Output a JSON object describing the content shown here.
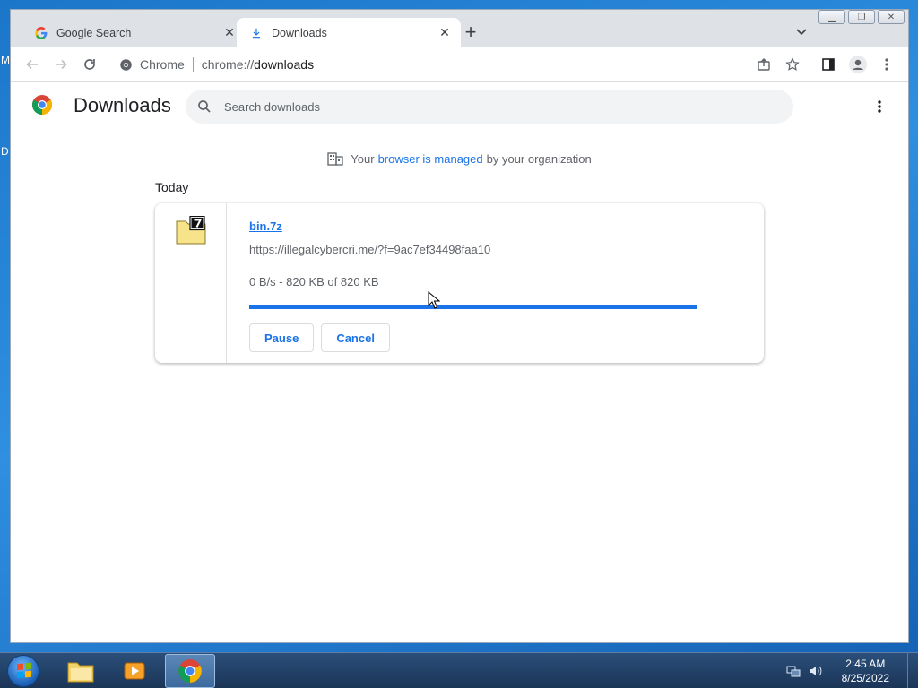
{
  "browser": {
    "tabs": [
      {
        "title": "Google Search",
        "icon": "google-icon"
      },
      {
        "title": "Downloads",
        "icon": "download-icon"
      }
    ],
    "omnibox": {
      "site_label": "Chrome",
      "url_prefix": "chrome://",
      "url_path": "downloads"
    }
  },
  "page": {
    "title": "Downloads",
    "search_placeholder": "Search downloads",
    "managed": {
      "prefix": "Your",
      "link": "browser is managed",
      "suffix": "by your organization"
    },
    "date_header": "Today",
    "download": {
      "file_name": "bin.7z",
      "url": "https://illegalcybercri.me/?f=9ac7ef34498faa10",
      "status": "0 B/s - 820 KB of 820 KB",
      "progress_percent": 100,
      "pause_label": "Pause",
      "cancel_label": "Cancel"
    }
  },
  "taskbar": {
    "time": "2:45 AM",
    "date": "8/25/2022"
  },
  "desktop": {
    "letters": [
      "M",
      "D"
    ]
  },
  "colors": {
    "accent": "#1a73e8",
    "tab_strip": "#dee1e6"
  }
}
